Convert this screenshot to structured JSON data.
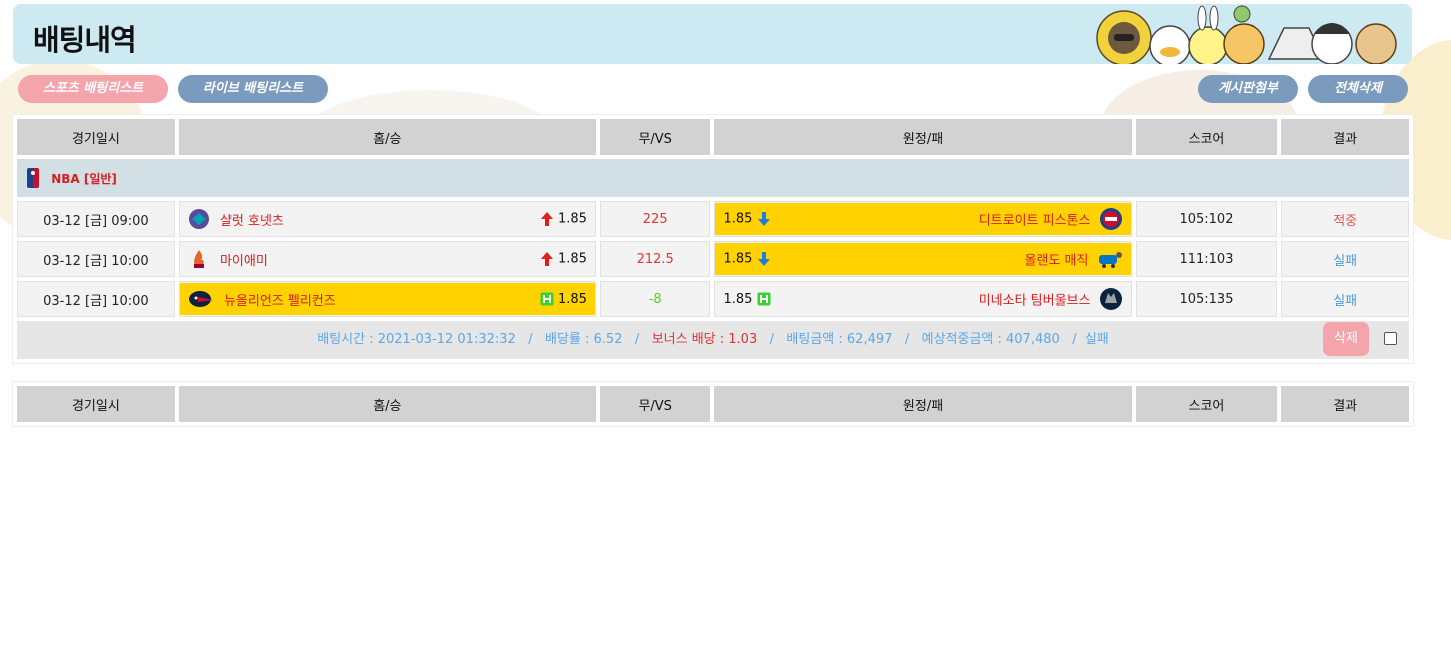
{
  "header": {
    "title": "배팅내역"
  },
  "tabs": {
    "sports": "스포츠 배팅리스트",
    "live": "라이브 배팅리스트"
  },
  "actions": {
    "board_attach": "게시판첨부",
    "delete_all": "전체삭제"
  },
  "columns": [
    "경기일시",
    "홈/승",
    "무/VS",
    "원정/패",
    "스코어",
    "결과"
  ],
  "league": {
    "name": "NBA [일반]"
  },
  "rows": [
    {
      "datetime": "03-12 [금] 09:00",
      "home": "샬럿 호넷츠",
      "home_odds": "1.85",
      "home_indicator": "up",
      "vs": "225",
      "away_odds": "1.85",
      "away_indicator": "down",
      "away": "디트로이트 피스톤스",
      "score": "105:102",
      "result": "적중",
      "selected": "away"
    },
    {
      "datetime": "03-12 [금] 10:00",
      "home": "마이애미",
      "home_odds": "1.85",
      "home_indicator": "up",
      "vs": "212.5",
      "away_odds": "1.85",
      "away_indicator": "down",
      "away": "올랜도 매직",
      "score": "111:103",
      "result": "실패",
      "selected": "away"
    },
    {
      "datetime": "03-12 [금] 10:00",
      "home": "뉴올리언즈 펠리컨즈",
      "home_odds": "1.85",
      "home_indicator": "H",
      "vs": "-8",
      "away_odds": "1.85",
      "away_indicator": "H",
      "away": "미네소타 팀버울브스",
      "score": "105:135",
      "result": "실패",
      "selected": "home"
    }
  ],
  "summary": {
    "bet_time": "배팅시간 : 2021-03-12 01:32:32",
    "odds": "배당률 : 6.52",
    "bonus": "보너스 배당 : 1.03",
    "amount": "배팅금액 : 62,497",
    "expected": "예상적중금액 : 407,480",
    "status": "실패",
    "sep": "/",
    "delete_label": "삭제"
  },
  "colors": {
    "pink": "#f3a5ab",
    "blue": "#7a9bbd",
    "selected": "#ffd200",
    "team_red": "#d91c1c",
    "hit": "#e05555",
    "fail": "#4a9be0"
  }
}
